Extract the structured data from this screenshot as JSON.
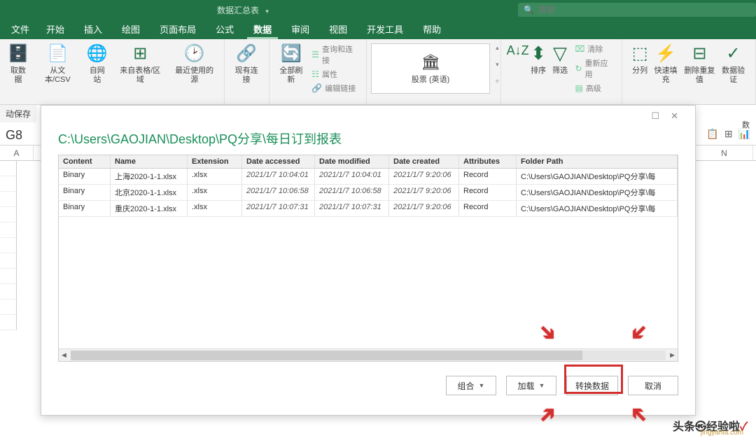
{
  "title_bar": {
    "workbook": "数据汇总表",
    "search_placeholder": "搜索"
  },
  "tabs": {
    "file": "文件",
    "home": "开始",
    "insert": "插入",
    "draw": "绘图",
    "layout": "页面布局",
    "formulas": "公式",
    "data": "数据",
    "review": "审阅",
    "view": "视图",
    "developer": "开发工具",
    "help": "帮助"
  },
  "ribbon": {
    "get_data": "取数据",
    "from_csv": "从文本/CSV",
    "from_web": "自网站",
    "from_table": "来自表格/区域",
    "recent": "最近使用的源",
    "existing": "现有连接",
    "refresh_all": "全部刷新",
    "queries": "查询和连接",
    "properties": "属性",
    "edit_links": "编辑链接",
    "stocks": "股票 (英语)",
    "sort": "排序",
    "filter": "筛选",
    "clear": "清除",
    "reapply": "重新应用",
    "advanced": "高级",
    "text_cols": "分列",
    "flash_fill": "快速填充",
    "remove_dup": "删除重复值",
    "data_val": "数据验证"
  },
  "autosave": "动保存",
  "name_box": "G8",
  "dialog": {
    "title": "C:\\Users\\GAOJIAN\\Desktop\\PQ分享\\每日订到报表",
    "headers": {
      "content": "Content",
      "name": "Name",
      "ext": "Extension",
      "accessed": "Date accessed",
      "modified": "Date modified",
      "created": "Date created",
      "attrs": "Attributes",
      "path": "Folder Path"
    },
    "rows": [
      {
        "content": "Binary",
        "name": "上海2020-1-1.xlsx",
        "ext": ".xlsx",
        "accessed": "2021/1/7 10:04:01",
        "modified": "2021/1/7 10:04:01",
        "created": "2021/1/7 9:20:06",
        "attrs": "Record",
        "path": "C:\\Users\\GAOJIAN\\Desktop\\PQ分享\\每"
      },
      {
        "content": "Binary",
        "name": "北京2020-1-1.xlsx",
        "ext": ".xlsx",
        "accessed": "2021/1/7 10:06:58",
        "modified": "2021/1/7 10:06:58",
        "created": "2021/1/7 9:20:06",
        "attrs": "Record",
        "path": "C:\\Users\\GAOJIAN\\Desktop\\PQ分享\\每"
      },
      {
        "content": "Binary",
        "name": "重庆2020-1-1.xlsx",
        "ext": ".xlsx",
        "accessed": "2021/1/7 10:07:31",
        "modified": "2021/1/7 10:07:31",
        "created": "2021/1/7 9:20:06",
        "attrs": "Record",
        "path": "C:\\Users\\GAOJIAN\\Desktop\\PQ分享\\每"
      }
    ],
    "buttons": {
      "combine": "组合",
      "load": "加载",
      "transform": "转换数据",
      "cancel": "取消"
    }
  },
  "columns": {
    "a": "A",
    "n": "N"
  },
  "watermark": {
    "main": "头条㉿经验啦",
    "check": "✓",
    "sub": "jingyanla.com"
  }
}
